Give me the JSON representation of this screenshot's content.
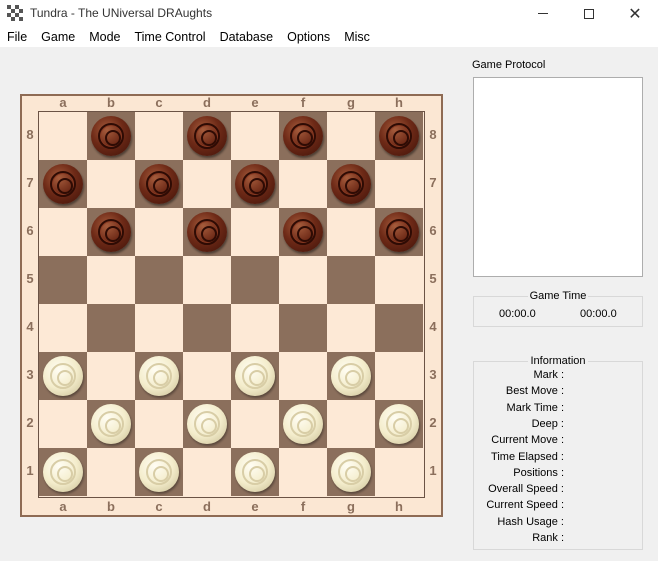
{
  "window": {
    "title": "Tundra - The UNiversal DRAughts",
    "minimize_glyph": "",
    "close_glyph": "✕"
  },
  "menu": [
    "File",
    "Game",
    "Mode",
    "Time Control",
    "Database",
    "Options",
    "Misc"
  ],
  "board": {
    "files": [
      "a",
      "b",
      "c",
      "d",
      "e",
      "f",
      "g",
      "h"
    ],
    "ranks": [
      "8",
      "7",
      "6",
      "5",
      "4",
      "3",
      "2",
      "1"
    ],
    "light_color": "#fde9d6",
    "dark_color": "#8b6f5c",
    "rows": [
      [
        "",
        "b",
        "",
        "b",
        "",
        "b",
        "",
        "b"
      ],
      [
        "b",
        "",
        "b",
        "",
        "b",
        "",
        "b",
        ""
      ],
      [
        "",
        "b",
        "",
        "b",
        "",
        "b",
        "",
        "b"
      ],
      [
        "",
        "",
        "",
        "",
        "",
        "",
        "",
        ""
      ],
      [
        "",
        "",
        "",
        "",
        "",
        "",
        "",
        ""
      ],
      [
        "w",
        "",
        "w",
        "",
        "w",
        "",
        "w",
        ""
      ],
      [
        "",
        "w",
        "",
        "w",
        "",
        "w",
        "",
        "w"
      ],
      [
        "w",
        "",
        "w",
        "",
        "w",
        "",
        "w",
        ""
      ]
    ]
  },
  "protocol": {
    "label": "Game Protocol"
  },
  "game_time": {
    "title": "Game Time",
    "left": "00:00.0",
    "right": "00:00.0"
  },
  "information": {
    "title": "Information",
    "rows": [
      "Mark :",
      "Best Move :",
      "Mark Time :",
      "Deep :",
      "Current Move :",
      "Time Elapsed :",
      "Positions :",
      "Overall Speed :",
      "Current Speed :",
      "Hash Usage :",
      "Rank :"
    ]
  }
}
